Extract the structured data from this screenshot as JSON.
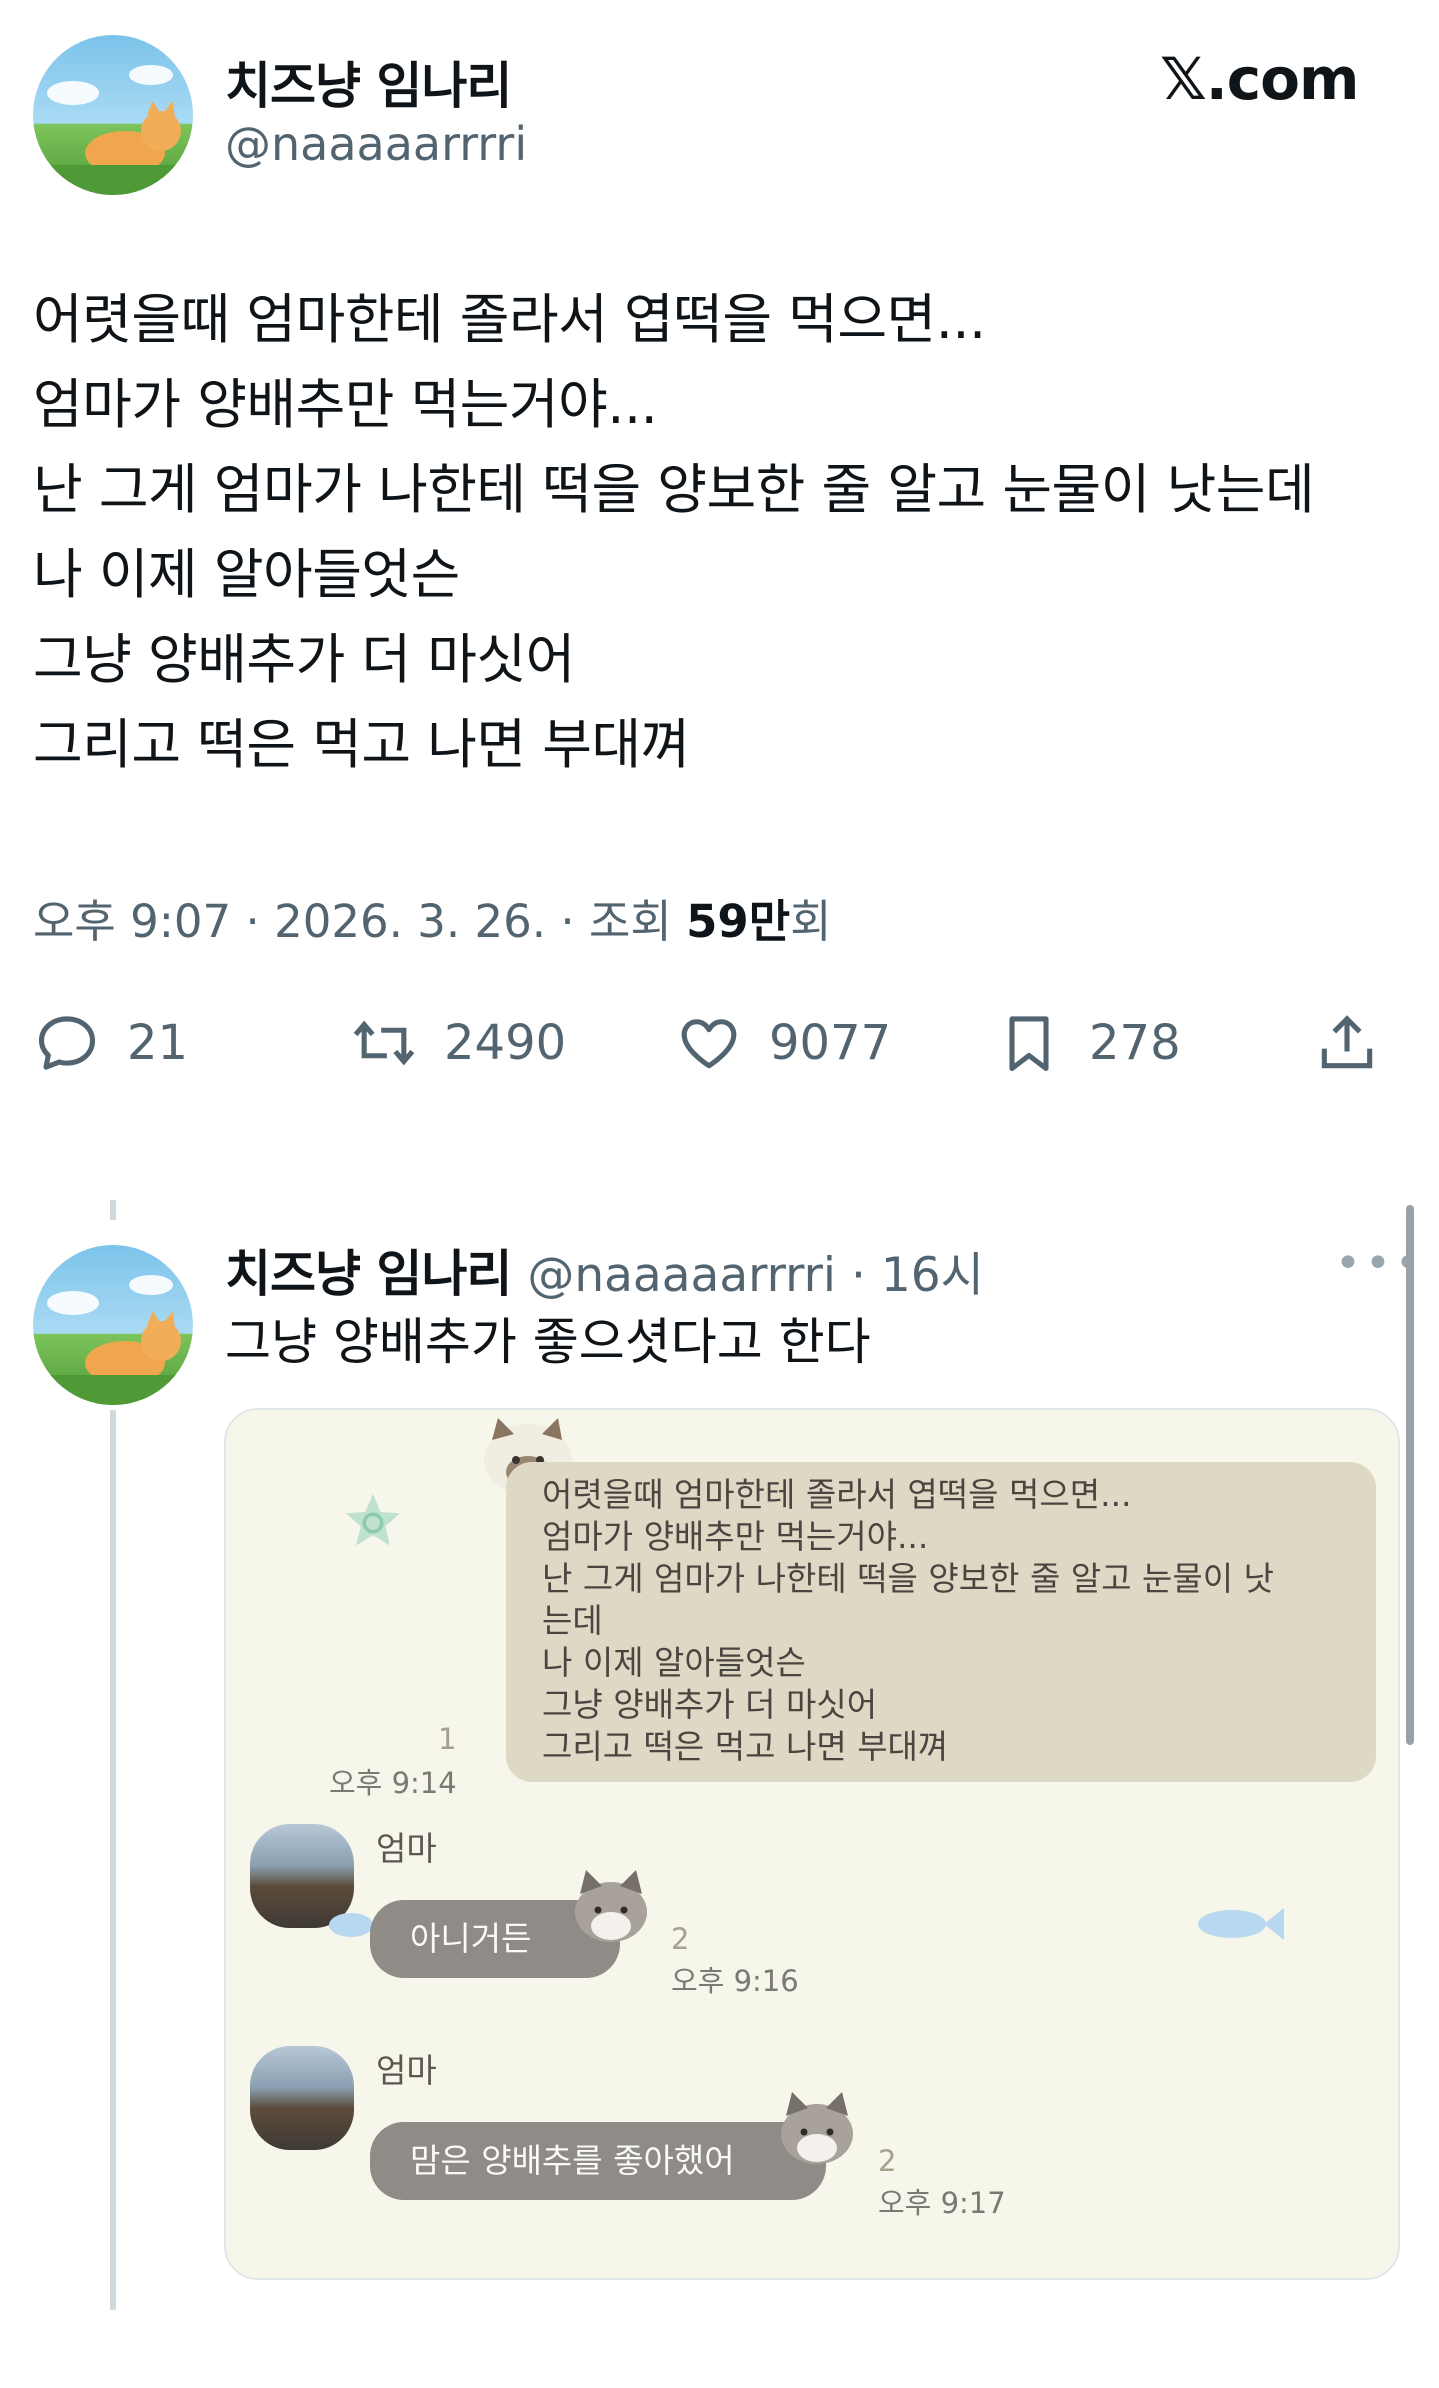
{
  "post": {
    "display_name": "치즈냥 임나리",
    "handle": "@naaaaarrrri",
    "site_logo": "𝕏.com",
    "lines": [
      "어렷을때 엄마한테 졸라서 엽떡을 먹으면...",
      "엄마가 양배추만 먹는거야...",
      "난 그게 엄마가 나한테 떡을 양보한 줄 알고 눈물이 낫는데",
      "나 이제 알아들엇슨",
      "그냥 양배추가 더 마싯어",
      "그리고 떡은 먹고 나면 부대껴"
    ],
    "time": "오후 9:07",
    "date": "2026. 3. 26.",
    "views_prefix": "조회",
    "views_count": "59만",
    "views_suffix": "회",
    "actions": {
      "replies": "21",
      "reposts": "2490",
      "likes": "9077",
      "bookmarks": "278"
    }
  },
  "icons": [
    "reply-icon",
    "repost-icon",
    "like-icon",
    "bookmark-icon",
    "share-icon",
    "more-icon"
  ],
  "reply": {
    "display_name": "치즈냥 임나리",
    "handle": "@naaaaarrrri",
    "age": "16시",
    "text": "그냥 양배추가 좋으셧다고 한다",
    "more": "•••"
  },
  "chat": {
    "sent": {
      "lines": [
        "어렷을때 엄마한테 졸라서 엽떡을 먹으면...",
        "엄마가 양배추만 먹는거야...",
        "난 그게 엄마가 나한테 떡을 양보한 줄 알고 눈물이 낫",
        "는데",
        "나 이제 알아들엇슨",
        "그냥 양배추가 더 마싯어",
        "그리고 떡은 먹고 나면 부대껴"
      ],
      "unread": "1",
      "time": "오후 9:14"
    },
    "received": [
      {
        "sender": "엄마",
        "text": "아니거든",
        "unread": "2",
        "time": "오후 9:16"
      },
      {
        "sender": "엄마",
        "text": "맘은 양배추를 좋아했어",
        "unread": "2",
        "time": "오후 9:17"
      }
    ]
  },
  "colors": {
    "text": "#0f1419",
    "secondary": "#536471",
    "chat_bg": "#f6f6ea",
    "sent_bubble": "#ded9c5",
    "received_bubble": "#8f8b86"
  }
}
